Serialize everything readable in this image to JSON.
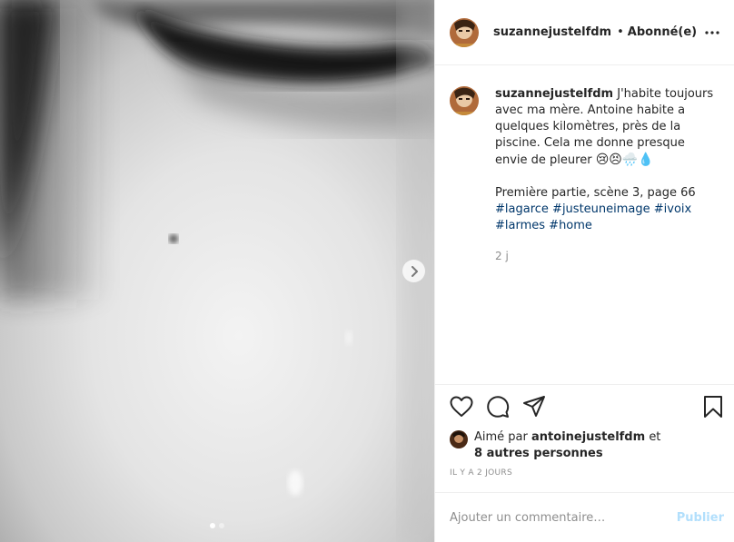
{
  "post": {
    "carousel": {
      "next_icon": "chevron-right-icon",
      "slide_count": 2,
      "active_slide": 1
    },
    "header": {
      "username": "suzannejustelfdm",
      "separator": "•",
      "follow_status": "Abonné(e)",
      "more_icon": "more-horizontal-icon"
    },
    "caption": {
      "username": "suzannejustelfdm",
      "text": "J'habite toujours avec ma mère. Antoine habite a quelques kilomètres, près de la piscine. Cela me donne presque envie de pleurer",
      "emojis": "😢😣🌧️💧",
      "line2": "Première partie, scène 3, page 66",
      "hashtags": [
        "#lagarce",
        "#justeuneimage",
        "#ivoix",
        "#larmes",
        "#home"
      ],
      "date": "2 j"
    },
    "actions": {
      "like_icon": "heart-icon",
      "comment_icon": "comment-icon",
      "share_icon": "paper-plane-icon",
      "save_icon": "bookmark-icon"
    },
    "likes": {
      "prefix": "Aimé par",
      "liker": "antoinejustelfdm",
      "joiner": "et",
      "others": "8 autres personnes"
    },
    "timestamp": "Il y a 2 jours",
    "comment": {
      "placeholder": "Ajouter un commentaire…",
      "publish_label": "Publier"
    }
  },
  "colors": {
    "text": "#262626",
    "secondary": "#8e8e8e",
    "hashtag": "#00376b",
    "publish_disabled": "#b2dffc",
    "border": "#efefef"
  }
}
